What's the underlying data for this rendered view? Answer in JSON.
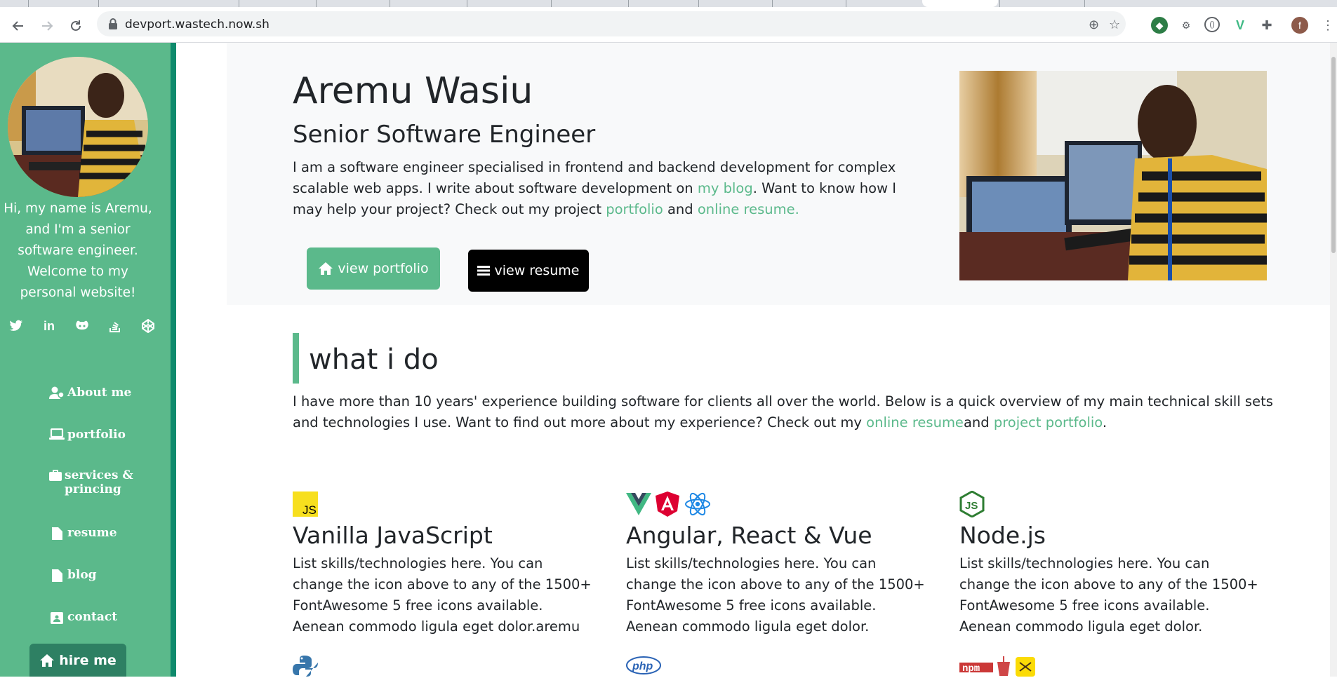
{
  "browser": {
    "url": "devport.wastech.now.sh",
    "profile_initial": "f"
  },
  "sidebar": {
    "intro": "Hi, my name is Aremu, and I'm a senior software engineer. Welcome to my personal website!",
    "socials": [
      "twitter-icon",
      "linkedin-icon",
      "github-icon",
      "stack-overflow-icon",
      "codepen-icon"
    ],
    "nav": [
      {
        "label": "About me",
        "icon": "user-icon"
      },
      {
        "label": "portfolio",
        "icon": "laptop-icon"
      },
      {
        "label": "services & princing",
        "icon": "briefcase-icon"
      },
      {
        "label": "resume",
        "icon": "file-icon"
      },
      {
        "label": "blog",
        "icon": "file-icon"
      },
      {
        "label": "contact",
        "icon": "id-badge-icon"
      }
    ],
    "hire_label": "hire me"
  },
  "hero": {
    "name": "Aremu Wasiu",
    "title": "Senior Software Engineer",
    "bio_1": "I am a software engineer specialised in frontend and backend development for complex scalable web apps. I write about software development on ",
    "bio_link_blog": "my blog",
    "bio_2": ". Want to know how I may help your project? Check out my project ",
    "bio_link_portfolio": "portfolio",
    "bio_3": " and ",
    "bio_link_resume": "online resume.",
    "btn_portfolio": "view portfolio",
    "btn_resume": "view resume"
  },
  "what_i_do": {
    "title": "what i do",
    "text_1": "I have more than 10 years' experience building software for clients all over the world. Below is a quick overview of my main technical skill sets and technologies I use. Want to find out more about my experience? Check out my ",
    "link_resume": "online resume",
    "text_2": "and ",
    "link_portfolio": "project portfolio",
    "text_3": "."
  },
  "skills": [
    {
      "title": "Vanilla JavaScript",
      "desc": "List skills/technologies here. You can change the icon above to any of the 1500+ FontAwesome 5 free icons available. Aenean commodo ligula eget dolor.aremu",
      "icons": [
        "js-icon"
      ]
    },
    {
      "title": "Angular, React & Vue",
      "desc": "List skills/technologies here. You can change the icon above to any of the 1500+ FontAwesome 5 free icons available. Aenean commodo ligula eget dolor.",
      "icons": [
        "vue-icon",
        "angular-icon",
        "react-icon"
      ]
    },
    {
      "title": "Node.js",
      "desc": "List skills/technologies here. You can change the icon above to any of the 1500+ FontAwesome 5 free icons available. Aenean commodo ligula eget dolor.",
      "icons": [
        "nodejs-icon"
      ]
    }
  ],
  "colors": {
    "accent": "#5bb98b",
    "accent_dark": "#0f8a6c",
    "hero_bg": "#f8f9fa"
  }
}
